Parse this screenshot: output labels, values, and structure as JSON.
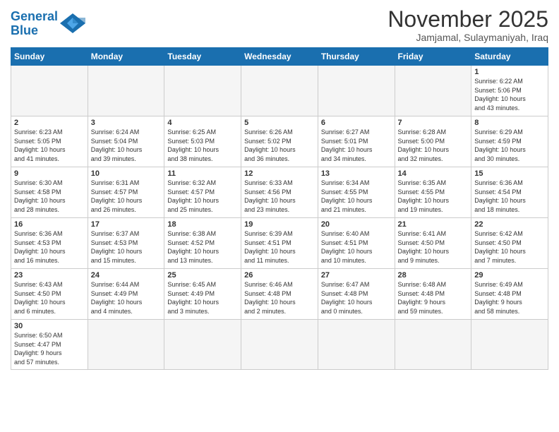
{
  "logo": {
    "text_general": "General",
    "text_blue": "Blue"
  },
  "title": "November 2025",
  "location": "Jamjamal, Sulaymaniyah, Iraq",
  "days_of_week": [
    "Sunday",
    "Monday",
    "Tuesday",
    "Wednesday",
    "Thursday",
    "Friday",
    "Saturday"
  ],
  "weeks": [
    [
      {
        "day": "",
        "info": ""
      },
      {
        "day": "",
        "info": ""
      },
      {
        "day": "",
        "info": ""
      },
      {
        "day": "",
        "info": ""
      },
      {
        "day": "",
        "info": ""
      },
      {
        "day": "",
        "info": ""
      },
      {
        "day": "1",
        "info": "Sunrise: 6:22 AM\nSunset: 5:06 PM\nDaylight: 10 hours\nand 43 minutes."
      }
    ],
    [
      {
        "day": "2",
        "info": "Sunrise: 6:23 AM\nSunset: 5:05 PM\nDaylight: 10 hours\nand 41 minutes."
      },
      {
        "day": "3",
        "info": "Sunrise: 6:24 AM\nSunset: 5:04 PM\nDaylight: 10 hours\nand 39 minutes."
      },
      {
        "day": "4",
        "info": "Sunrise: 6:25 AM\nSunset: 5:03 PM\nDaylight: 10 hours\nand 38 minutes."
      },
      {
        "day": "5",
        "info": "Sunrise: 6:26 AM\nSunset: 5:02 PM\nDaylight: 10 hours\nand 36 minutes."
      },
      {
        "day": "6",
        "info": "Sunrise: 6:27 AM\nSunset: 5:01 PM\nDaylight: 10 hours\nand 34 minutes."
      },
      {
        "day": "7",
        "info": "Sunrise: 6:28 AM\nSunset: 5:00 PM\nDaylight: 10 hours\nand 32 minutes."
      },
      {
        "day": "8",
        "info": "Sunrise: 6:29 AM\nSunset: 4:59 PM\nDaylight: 10 hours\nand 30 minutes."
      }
    ],
    [
      {
        "day": "9",
        "info": "Sunrise: 6:30 AM\nSunset: 4:58 PM\nDaylight: 10 hours\nand 28 minutes."
      },
      {
        "day": "10",
        "info": "Sunrise: 6:31 AM\nSunset: 4:57 PM\nDaylight: 10 hours\nand 26 minutes."
      },
      {
        "day": "11",
        "info": "Sunrise: 6:32 AM\nSunset: 4:57 PM\nDaylight: 10 hours\nand 25 minutes."
      },
      {
        "day": "12",
        "info": "Sunrise: 6:33 AM\nSunset: 4:56 PM\nDaylight: 10 hours\nand 23 minutes."
      },
      {
        "day": "13",
        "info": "Sunrise: 6:34 AM\nSunset: 4:55 PM\nDaylight: 10 hours\nand 21 minutes."
      },
      {
        "day": "14",
        "info": "Sunrise: 6:35 AM\nSunset: 4:55 PM\nDaylight: 10 hours\nand 19 minutes."
      },
      {
        "day": "15",
        "info": "Sunrise: 6:36 AM\nSunset: 4:54 PM\nDaylight: 10 hours\nand 18 minutes."
      }
    ],
    [
      {
        "day": "16",
        "info": "Sunrise: 6:36 AM\nSunset: 4:53 PM\nDaylight: 10 hours\nand 16 minutes."
      },
      {
        "day": "17",
        "info": "Sunrise: 6:37 AM\nSunset: 4:53 PM\nDaylight: 10 hours\nand 15 minutes."
      },
      {
        "day": "18",
        "info": "Sunrise: 6:38 AM\nSunset: 4:52 PM\nDaylight: 10 hours\nand 13 minutes."
      },
      {
        "day": "19",
        "info": "Sunrise: 6:39 AM\nSunset: 4:51 PM\nDaylight: 10 hours\nand 11 minutes."
      },
      {
        "day": "20",
        "info": "Sunrise: 6:40 AM\nSunset: 4:51 PM\nDaylight: 10 hours\nand 10 minutes."
      },
      {
        "day": "21",
        "info": "Sunrise: 6:41 AM\nSunset: 4:50 PM\nDaylight: 10 hours\nand 9 minutes."
      },
      {
        "day": "22",
        "info": "Sunrise: 6:42 AM\nSunset: 4:50 PM\nDaylight: 10 hours\nand 7 minutes."
      }
    ],
    [
      {
        "day": "23",
        "info": "Sunrise: 6:43 AM\nSunset: 4:50 PM\nDaylight: 10 hours\nand 6 minutes."
      },
      {
        "day": "24",
        "info": "Sunrise: 6:44 AM\nSunset: 4:49 PM\nDaylight: 10 hours\nand 4 minutes."
      },
      {
        "day": "25",
        "info": "Sunrise: 6:45 AM\nSunset: 4:49 PM\nDaylight: 10 hours\nand 3 minutes."
      },
      {
        "day": "26",
        "info": "Sunrise: 6:46 AM\nSunset: 4:48 PM\nDaylight: 10 hours\nand 2 minutes."
      },
      {
        "day": "27",
        "info": "Sunrise: 6:47 AM\nSunset: 4:48 PM\nDaylight: 10 hours\nand 0 minutes."
      },
      {
        "day": "28",
        "info": "Sunrise: 6:48 AM\nSunset: 4:48 PM\nDaylight: 9 hours\nand 59 minutes."
      },
      {
        "day": "29",
        "info": "Sunrise: 6:49 AM\nSunset: 4:48 PM\nDaylight: 9 hours\nand 58 minutes."
      }
    ],
    [
      {
        "day": "30",
        "info": "Sunrise: 6:50 AM\nSunset: 4:47 PM\nDaylight: 9 hours\nand 57 minutes."
      },
      {
        "day": "",
        "info": ""
      },
      {
        "day": "",
        "info": ""
      },
      {
        "day": "",
        "info": ""
      },
      {
        "day": "",
        "info": ""
      },
      {
        "day": "",
        "info": ""
      },
      {
        "day": "",
        "info": ""
      }
    ]
  ],
  "accent_color": "#1a6faf"
}
